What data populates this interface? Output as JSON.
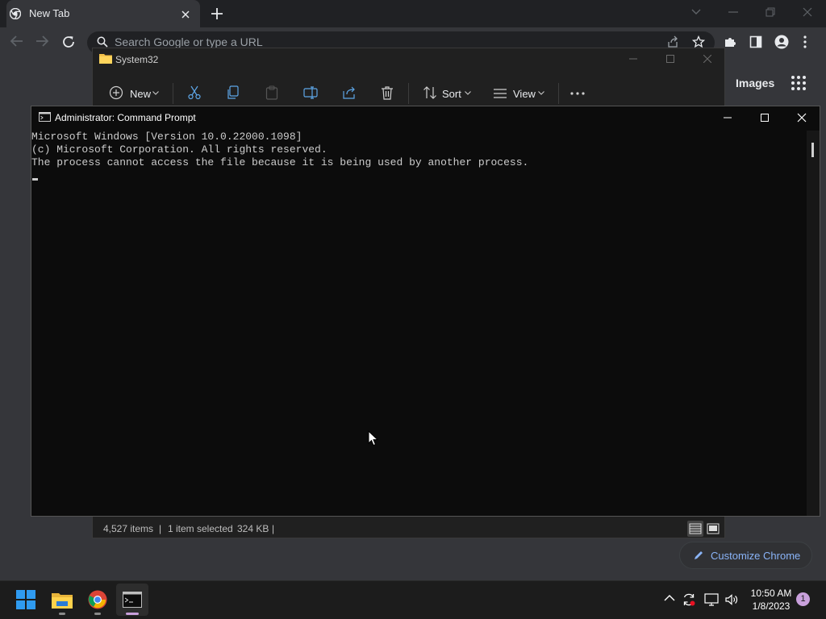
{
  "chrome": {
    "tab_title": "New Tab",
    "omnibox_placeholder": "Search Google or type a URL",
    "images_link": "Images",
    "customize_label": "Customize Chrome",
    "colors": {
      "frame": "#202124",
      "toolbar": "#35363a",
      "link": "#8ab4f8"
    }
  },
  "explorer": {
    "title": "System32",
    "commands": {
      "new_label": "New",
      "sort_label": "Sort",
      "view_label": "View"
    },
    "status": {
      "items": "4,527 items",
      "sep": "|",
      "selected": "1 item selected",
      "size": "324 KB",
      "sep2": "|"
    }
  },
  "cmd": {
    "title": "Administrator: Command Prompt",
    "lines": [
      "Microsoft Windows [Version 10.0.22000.1098]",
      "(c) Microsoft Corporation. All rights reserved.",
      "The process cannot access the file because it is being used by another process."
    ]
  },
  "taskbar": {
    "time": "10:50 AM",
    "date": "1/8/2023",
    "notification_count": "1"
  }
}
